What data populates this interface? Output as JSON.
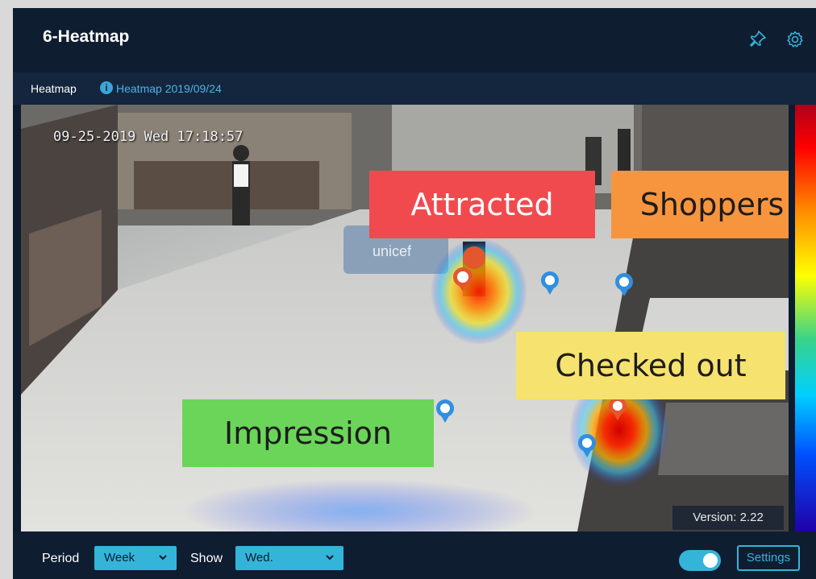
{
  "widget": {
    "title": "6-Heatmap",
    "pin_icon": "pin-icon",
    "settings_icon": "gear-icon"
  },
  "subheader": {
    "label": "Heatmap",
    "info_icon": "info-icon",
    "date_text": "Heatmap 2019/09/24"
  },
  "video": {
    "timestamp": "09-25-2019 Wed 17:18:57",
    "sign_text": "unicef",
    "version": "Version: 2.22"
  },
  "labels": {
    "attracted": "Attracted",
    "shoppers": "Shoppers",
    "checked_out": "Checked out",
    "impression": "Impression"
  },
  "colors": {
    "attracted": "#f04a4f",
    "shoppers": "#f7953f",
    "checked_out": "#f6e26e",
    "impression": "#6bd559",
    "accent": "#34b4d8",
    "panel_bg": "#0d1b2e"
  },
  "footer": {
    "period_label": "Period",
    "period_value": "Week",
    "show_label": "Show",
    "show_value": "Wed.",
    "toggle_on": true,
    "settings_label": "Settings"
  }
}
